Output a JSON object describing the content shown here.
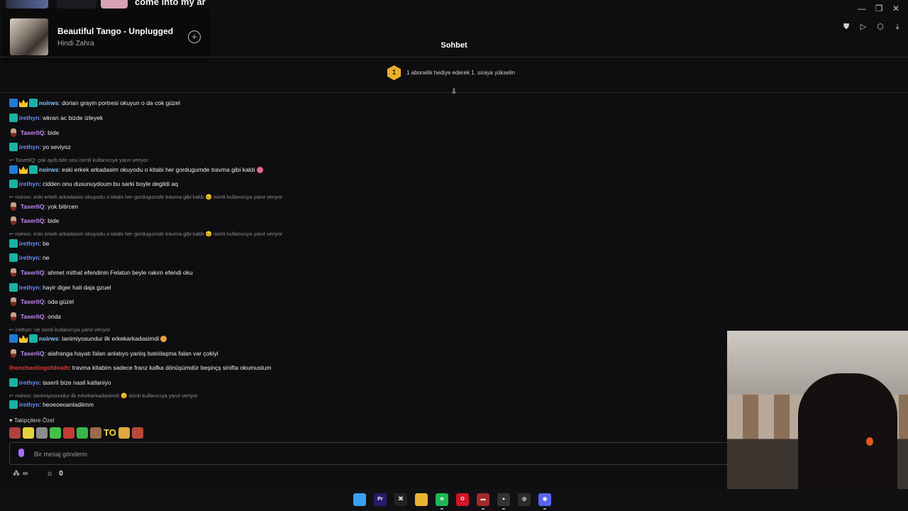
{
  "window": {
    "controls": [
      "—",
      "❐",
      "✕"
    ],
    "tools": [
      "⛊",
      "▷",
      "⬡",
      "⤓"
    ]
  },
  "media": {
    "strip_text": "come into my ar",
    "track_title": "Beautiful Tango - Unplugged",
    "artist": "Hindi Zahra",
    "add_icon": "+"
  },
  "chat": {
    "title": "Sohbet",
    "leaderboard": {
      "rank": "1",
      "text": "1 abonelik hediye ederek 1. sıraya yükselin"
    },
    "scroll_icon": "⇩"
  },
  "messages": [
    {
      "type": "msg",
      "badges": [
        "mod",
        "crown",
        "sub"
      ],
      "user": "noirws",
      "cls": "u-noirws",
      "text": ": dorian grayin portresi okuyun o da cok güzel"
    },
    {
      "type": "msg",
      "badges": [
        "sub"
      ],
      "user": "irethyn",
      "cls": "u-irethyn",
      "text": ": wkran ac bizde izleyek"
    },
    {
      "type": "msg",
      "badges": [
        "guitar"
      ],
      "user": "TaserliQ",
      "cls": "u-taserliq",
      "text": ": bide"
    },
    {
      "type": "msg",
      "badges": [
        "sub"
      ],
      "user": "irethyn",
      "cls": "u-irethyn",
      "text": ": yo seviyoz"
    },
    {
      "type": "reply",
      "text": "TaserliQ: çok ayıb bitir onu isimli kullanıcıya yanıt veriyor"
    },
    {
      "type": "msg",
      "badges": [
        "mod",
        "crown",
        "sub"
      ],
      "user": "noirws",
      "cls": "u-noirws",
      "text": ": eski erkek arkadasim okuyodu o kitabi her gordugumde travma gibi kaldı",
      "emoji": "#e06a8a"
    },
    {
      "type": "msg",
      "badges": [
        "sub"
      ],
      "user": "irethyn",
      "cls": "u-irethyn",
      "text": ": cidden onu dusunuydoum bu sarki boyle degildi aq"
    },
    {
      "type": "reply",
      "text": "noirws: eski erkek arkadasim okuyodu o kitabi her gordugumde travma gibi kaldı 😣 isimli kullanıcıya yanıt veriyor"
    },
    {
      "type": "msg",
      "badges": [
        "guitar"
      ],
      "user": "TaserliQ",
      "cls": "u-taserliq",
      "text": ": yok bitircen"
    },
    {
      "type": "msg",
      "badges": [
        "guitar"
      ],
      "user": "TaserliQ",
      "cls": "u-taserliq",
      "text": ": bide"
    },
    {
      "type": "reply",
      "text": "noirws: eski erkek arkadasim okuyodu o kitabi her gordugumde travma gibi kaldı 😣 isimli kullanıcıya yanıt veriyor"
    },
    {
      "type": "msg",
      "badges": [
        "sub"
      ],
      "user": "irethyn",
      "cls": "u-irethyn",
      "text": ": be"
    },
    {
      "type": "msg",
      "badges": [
        "sub"
      ],
      "user": "irethyn",
      "cls": "u-irethyn",
      "text": ": ne"
    },
    {
      "type": "msg",
      "badges": [
        "guitar"
      ],
      "user": "TaserliQ",
      "cls": "u-taserliq",
      "text": ": ahmet mithat efendinin Felatun beyle rakım efendi oku"
    },
    {
      "type": "msg",
      "badges": [
        "sub"
      ],
      "user": "irethyn",
      "cls": "u-irethyn",
      "text": ": hayir diger hali daja gzuel"
    },
    {
      "type": "msg",
      "badges": [
        "guitar"
      ],
      "user": "TaserliQ",
      "cls": "u-taserliq",
      "text": ": oda güzel"
    },
    {
      "type": "msg",
      "badges": [
        "guitar"
      ],
      "user": "TaserliQ",
      "cls": "u-taserliq",
      "text": ": onda"
    },
    {
      "type": "reply",
      "text": "irethyn: ne isimli kullanıcıya yanıt veriyor"
    },
    {
      "type": "msg",
      "badges": [
        "mod",
        "crown",
        "sub"
      ],
      "user": "noirws",
      "cls": "u-noirws",
      "text": ": tanimiyosundur ilk erkekarkadasimdi",
      "emoji": "#e9a13a"
    },
    {
      "type": "msg",
      "badges": [
        "guitar"
      ],
      "user": "TaserliQ",
      "cls": "u-taserliq",
      "text": ": alafranga hayatı falan anlatıyo yanlış batılılaşma falan var çokiyi"
    },
    {
      "type": "msg",
      "badges": [],
      "user": "thenchantingofdeath",
      "cls": "u-thench",
      "text": ": travma kitabim sadece franz kafka dönüşümdür beşinçş sinifta okumustum"
    },
    {
      "type": "msg",
      "badges": [
        "sub"
      ],
      "user": "irethyn",
      "cls": "u-irethyn",
      "text": ": taserli bize nasil katlaniyo"
    },
    {
      "type": "reply",
      "text": "noirws: tanimiyosundur ilk erkekarkadasimdi 😊 isimli kullanıcıya yanıt veriyor"
    },
    {
      "type": "msg",
      "badges": [
        "sub"
      ],
      "user": "irethyn",
      "cls": "u-irethyn",
      "text": ": heoeoeoanladiimm"
    }
  ],
  "follower_emotes": {
    "label": "Takipçilere Özel",
    "heart": "♥",
    "emotes": [
      "#b0413e",
      "#e5d23a",
      "#8c8c8c",
      "#46c04a",
      "#c43a3a",
      "#38b648",
      "#9a6a4a",
      "TO",
      "#e2a83a",
      "#b74a3a"
    ]
  },
  "input": {
    "placeholder": "Bir mesaj gönderin"
  },
  "bottom": {
    "points_icon": "∞",
    "cart_count": "0"
  },
  "taskbar": {
    "icons": [
      {
        "name": "windows-start",
        "color": "#3aa0f2",
        "label": ""
      },
      {
        "name": "premiere",
        "color": "#2a1a6a",
        "label": "Pr"
      },
      {
        "name": "capcut",
        "color": "#222222",
        "label": "⌘"
      },
      {
        "name": "file-explorer",
        "color": "#e8b431",
        "label": ""
      },
      {
        "name": "spotify",
        "color": "#1db954",
        "label": "≋"
      },
      {
        "name": "opera",
        "color": "#d0152a",
        "label": "O"
      },
      {
        "name": "app-red",
        "color": "#a3282a",
        "label": "▬"
      },
      {
        "name": "obs-mouse",
        "color": "#333333",
        "label": "⌖"
      },
      {
        "name": "obs",
        "color": "#2b2b2b",
        "label": "◎"
      },
      {
        "name": "discord",
        "color": "#5865f2",
        "label": "◉"
      }
    ]
  }
}
